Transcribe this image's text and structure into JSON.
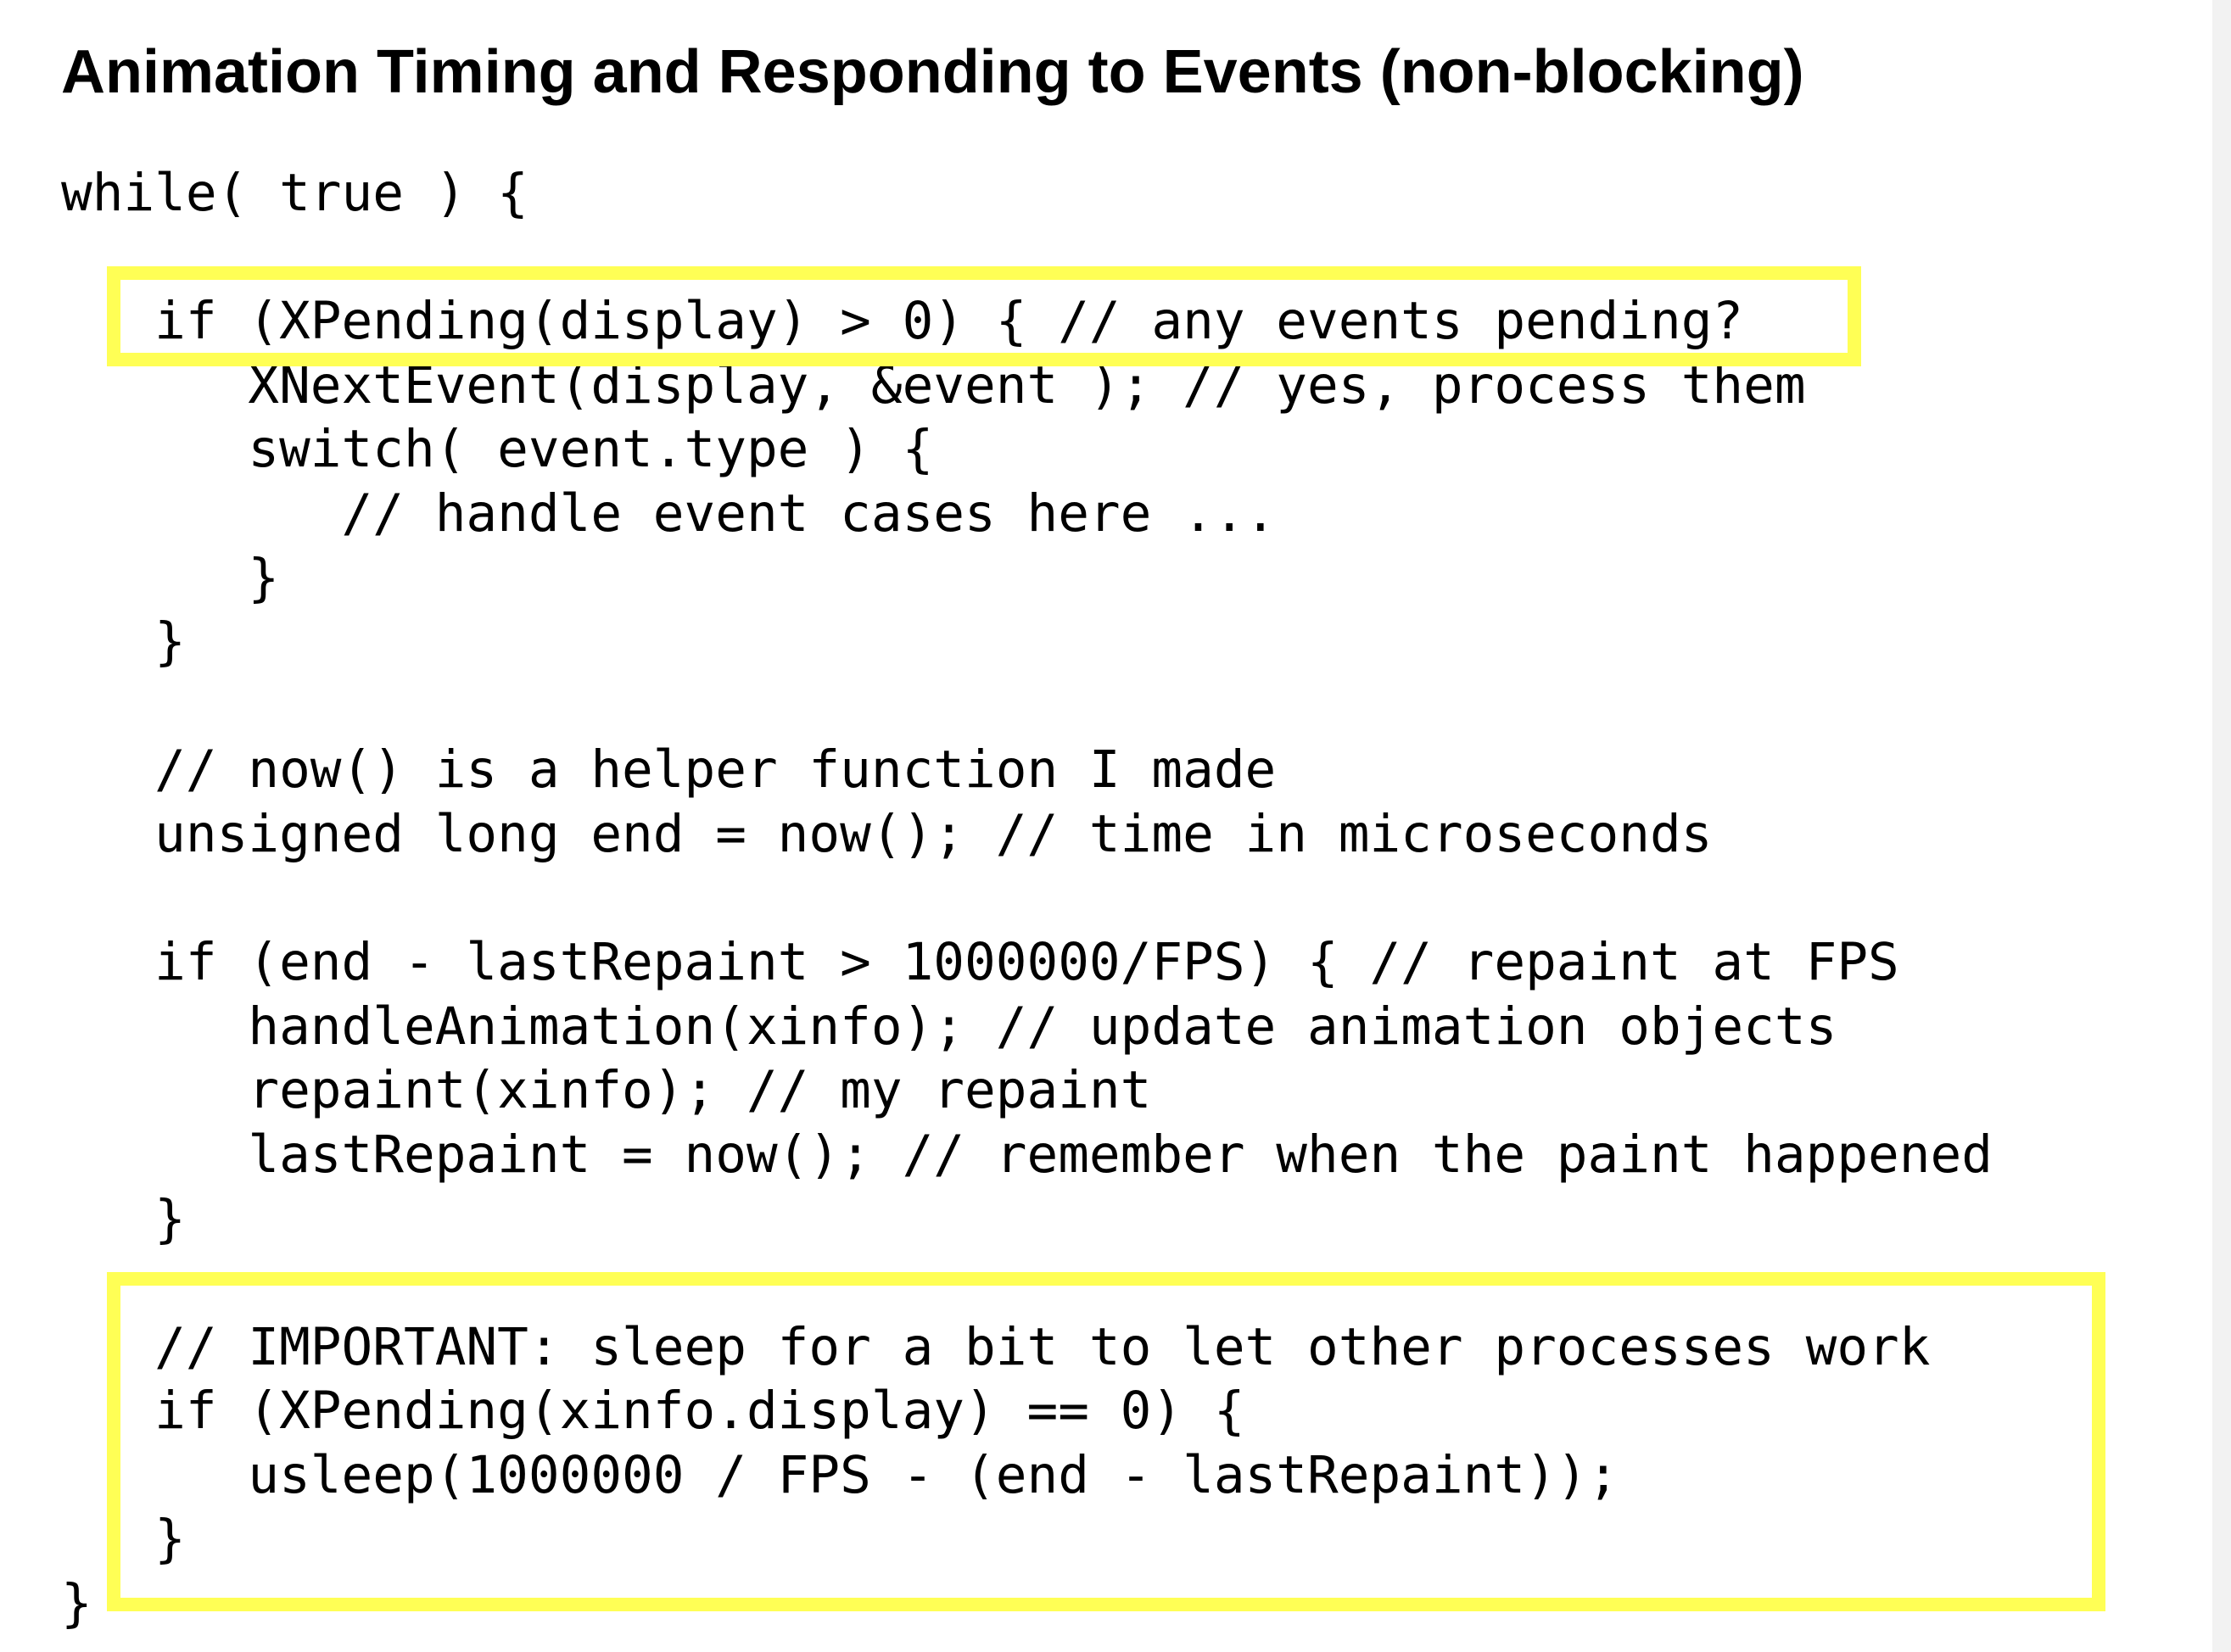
{
  "slide": {
    "title": "Animation Timing and Responding to Events (non-blocking)",
    "code_lines": [
      "while( true ) {",
      "",
      "   if (XPending(display) > 0) { // any events pending?",
      "      XNextEvent(display, &event ); // yes, process them",
      "      switch( event.type ) {",
      "         // handle event cases here ...",
      "      }",
      "   }",
      "",
      "   // now() is a helper function I made",
      "   unsigned long end = now(); // time in microseconds",
      "",
      "   if (end - lastRepaint > 1000000/FPS) { // repaint at FPS",
      "      handleAnimation(xinfo); // update animation objects",
      "      repaint(xinfo); // my repaint",
      "      lastRepaint = now(); // remember when the paint happened",
      "   }",
      "",
      "   // IMPORTANT: sleep for a bit to let other processes work",
      "   if (XPending(xinfo.display) == 0) {",
      "      usleep(1000000 / FPS - (end - lastRepaint));",
      "   }",
      "}"
    ],
    "highlight_color": "#ffff55"
  }
}
